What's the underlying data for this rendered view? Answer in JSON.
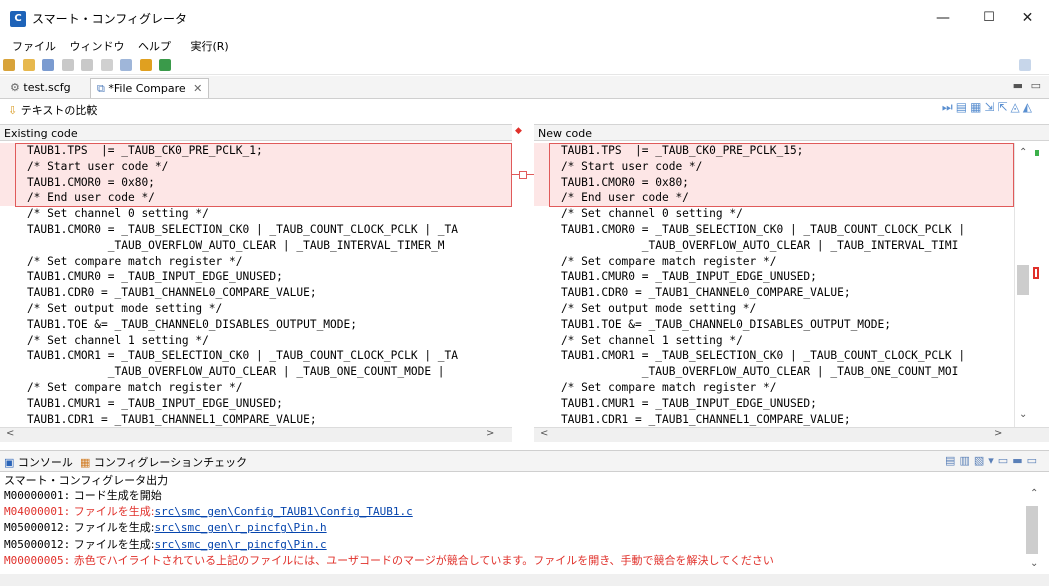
{
  "window": {
    "title": "スマート・コンフィグレータ",
    "app_icon_label": "C",
    "minimize": "—",
    "maximize": "☐",
    "close": "✕"
  },
  "menu": [
    "ファイル",
    "ウィンドウ",
    "ヘルプ",
    "実行(R)"
  ],
  "tabs": [
    {
      "label": "test.scfg"
    },
    {
      "label": "*File Compare",
      "close": "✕"
    }
  ],
  "compare": {
    "title": "テキストの比較",
    "left_header": "Existing code",
    "right_header": "New code",
    "left_lines": [
      "    TAUB1.TPS  |= _TAUB_CK0_PRE_PCLK_1;",
      "    /* Start user code */",
      "    TAUB1.CMOR0 = 0x80;",
      "    /* End user code */",
      "    /* Set channel 0 setting */",
      "    TAUB1.CMOR0 = _TAUB_SELECTION_CK0 | _TAUB_COUNT_CLOCK_PCLK | _TA",
      "                _TAUB_OVERFLOW_AUTO_CLEAR | _TAUB_INTERVAL_TIMER_M",
      "    /* Set compare match register */",
      "    TAUB1.CMUR0 = _TAUB_INPUT_EDGE_UNUSED;",
      "    TAUB1.CDR0 = _TAUB1_CHANNEL0_COMPARE_VALUE;",
      "    /* Set output mode setting */",
      "    TAUB1.TOE &= _TAUB_CHANNEL0_DISABLES_OUTPUT_MODE;",
      "    /* Set channel 1 setting */",
      "    TAUB1.CMOR1 = _TAUB_SELECTION_CK0 | _TAUB_COUNT_CLOCK_PCLK | _TA",
      "                _TAUB_OVERFLOW_AUTO_CLEAR | _TAUB_ONE_COUNT_MODE |",
      "    /* Set compare match register */",
      "    TAUB1.CMUR1 = _TAUB_INPUT_EDGE_UNUSED;",
      "    TAUB1.CDR1 = _TAUB1_CHANNEL1_COMPARE_VALUE;"
    ],
    "right_lines": [
      "    TAUB1.TPS  |= _TAUB_CK0_PRE_PCLK_15;",
      "    /* Start user code */",
      "    TAUB1.CMOR0 = 0x80;",
      "    /* End user code */",
      "    /* Set channel 0 setting */",
      "    TAUB1.CMOR0 = _TAUB_SELECTION_CK0 | _TAUB_COUNT_CLOCK_PCLK |",
      "                _TAUB_OVERFLOW_AUTO_CLEAR | _TAUB_INTERVAL_TIMI",
      "    /* Set compare match register */",
      "    TAUB1.CMUR0 = _TAUB_INPUT_EDGE_UNUSED;",
      "    TAUB1.CDR0 = _TAUB1_CHANNEL0_COMPARE_VALUE;",
      "    /* Set output mode setting */",
      "    TAUB1.TOE &= _TAUB_CHANNEL0_DISABLES_OUTPUT_MODE;",
      "    /* Set channel 1 setting */",
      "    TAUB1.CMOR1 = _TAUB_SELECTION_CK0 | _TAUB_COUNT_CLOCK_PCLK |",
      "                _TAUB_OVERFLOW_AUTO_CLEAR | _TAUB_ONE_COUNT_MOI",
      "    /* Set compare match register */",
      "    TAUB1.CMUR1 = _TAUB_INPUT_EDGE_UNUSED;",
      "    TAUB1.CDR1 = _TAUB1_CHANNEL1_COMPARE_VALUE;"
    ]
  },
  "console": {
    "tab_console": "コンソール",
    "tab_check": "コンフィグレーションチェック",
    "title": "スマート・コンフィグレータ出力",
    "lines": [
      {
        "code": "M00000001:",
        "msg": " コード生成を開始",
        "link": "",
        "error": false
      },
      {
        "code": "M04000001:",
        "msg": " ファイルを生成:",
        "link": "src\\smc_gen\\Config_TAUB1\\Config_TAUB1.c",
        "error": true
      },
      {
        "code": "M05000012:",
        "msg": " ファイルを生成:",
        "link": "src\\smc_gen\\r_pincfg\\Pin.h",
        "error": false
      },
      {
        "code": "M05000012:",
        "msg": " ファイルを生成:",
        "link": "src\\smc_gen\\r_pincfg\\Pin.c",
        "error": false
      },
      {
        "code": "M00000005:",
        "msg": " 赤色でハイライトされている上記のファイルには、ユーザコードのマージが競合しています。ファイルを開き、手動で競合を解決してください",
        "link": "",
        "error": true
      }
    ]
  },
  "colors": {
    "accent": "#1e63b8",
    "error": "#e0302a",
    "diff_border": "#e05a5a",
    "diff_fill": "#fde6e6",
    "link": "#0645ad"
  }
}
